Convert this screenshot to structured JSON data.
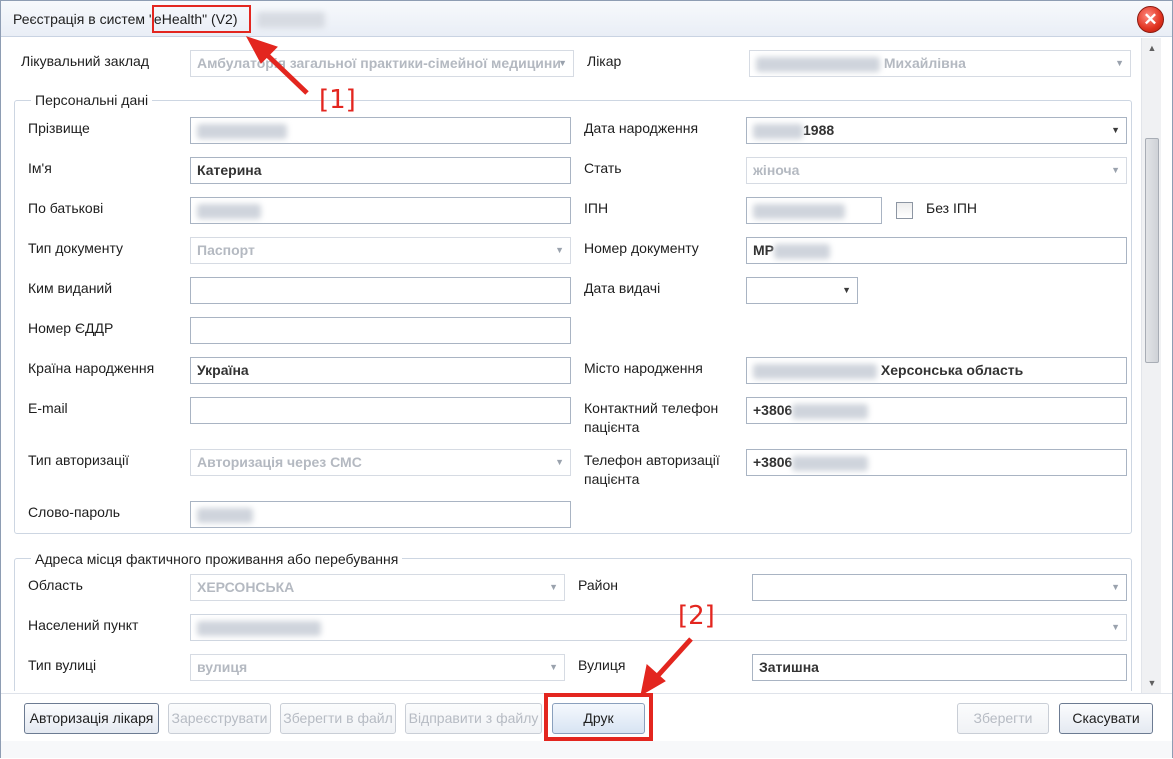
{
  "window": {
    "title_prefix": "Реєстрація в систем",
    "title_highlight": "\"eHealth\" (V2)",
    "close_glyph": "✕"
  },
  "top": {
    "facility_label": "Лікувальний заклад",
    "facility_value": "Амбулаторія загальної практики-сімейної медицини",
    "doctor_label": "Лікар",
    "doctor_value_visible": "Михайлівна"
  },
  "personal": {
    "group_title": "Персональні дані",
    "surname_label": "Прізвище",
    "name_label": "Ім'я",
    "name_value": "Катерина",
    "patronymic_label": "По батькові",
    "doc_type_label": "Тип документу",
    "doc_type_value": "Паспорт",
    "issued_by_label": "Ким виданий",
    "issued_by_value": "",
    "edrr_label": "Номер ЄДДР",
    "edrr_value": "",
    "birth_country_label": "Країна народження",
    "birth_country_value": "Україна",
    "email_label": "E-mail",
    "email_value": "",
    "auth_type_label": "Тип авторизації",
    "auth_type_value": "Авторизація через СМС",
    "password_label": "Слово-пароль",
    "birth_date_label": "Дата народження",
    "birth_date_visible": "1988",
    "sex_label": "Стать",
    "sex_value": "жіноча",
    "ipn_label": "ІПН",
    "no_ipn_label": "Без ІПН",
    "doc_number_label": "Номер документу",
    "doc_number_visible": "МР",
    "issue_date_label": "Дата видачі",
    "birth_city_label": "Місто народження",
    "birth_city_visible": "Херсонська область",
    "contact_phone_label": "Контактний телефон пацієнта",
    "contact_phone_visible": "+3806",
    "auth_phone_label": "Телефон авторизації пацієнта",
    "auth_phone_visible": "+3806"
  },
  "address": {
    "group_title": "Адреса місця фактичного проживання або перебування",
    "region_label": "Область",
    "region_value": "ХЕРСОНСЬКА",
    "district_label": "Район",
    "district_value": "",
    "settlement_label": "Населений пункт",
    "street_type_label": "Тип вулиці",
    "street_type_value": "вулиця",
    "street_label": "Вулиця",
    "street_value": "Затишна"
  },
  "buttons": {
    "doctor_auth": "Авторизація лікаря",
    "register": "Зареєструвати",
    "save_file": "Зберегти в файл",
    "send_file": "Відправити з файлу",
    "print": "Друк",
    "save": "Зберегти",
    "cancel": "Скасувати"
  },
  "annotations": {
    "first": "[1]",
    "second": "[2]"
  },
  "icons": {
    "dropdown": "▼",
    "scroll_up": "▲",
    "scroll_down": "▼"
  },
  "colors": {
    "annotation_red": "#e3261f"
  }
}
